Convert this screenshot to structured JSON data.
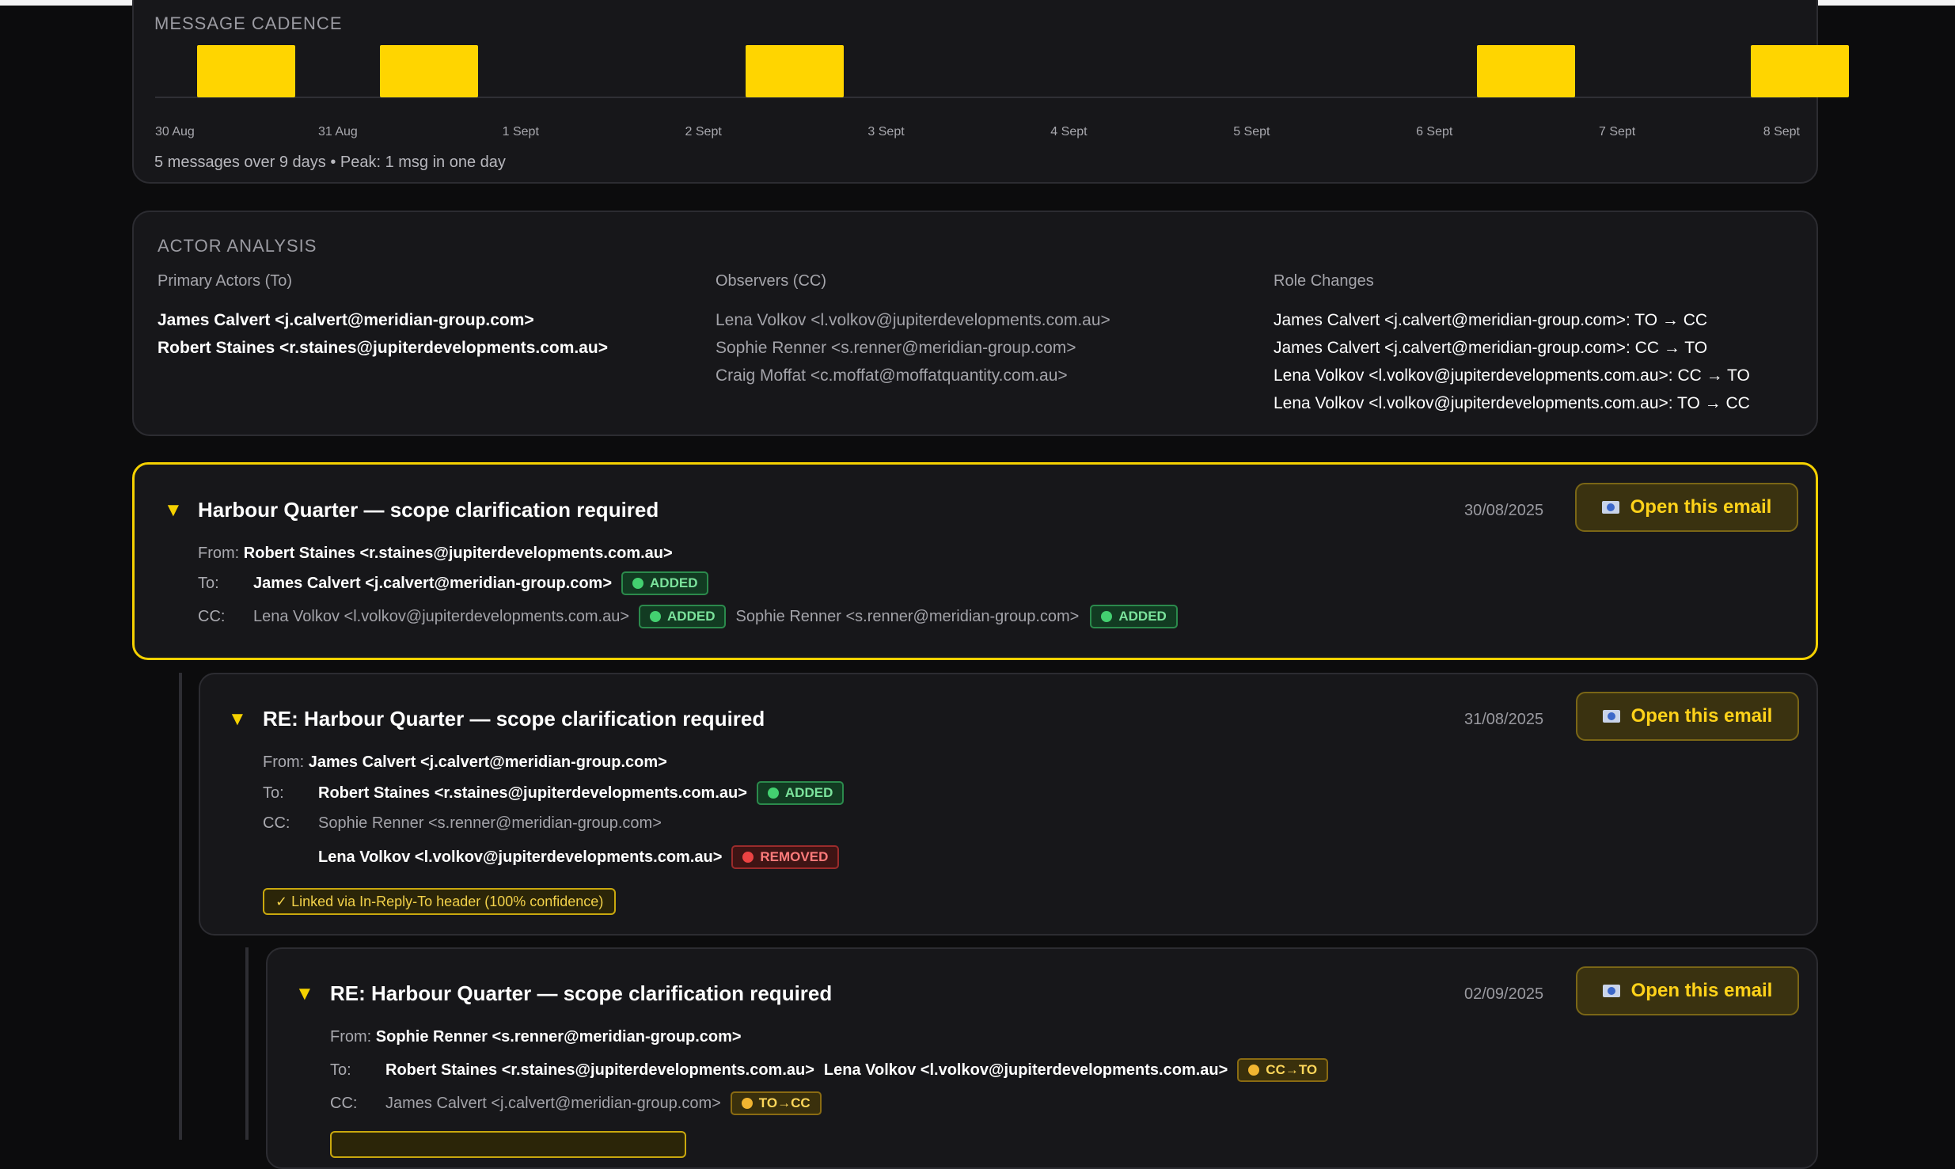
{
  "cadence": {
    "title": "MESSAGE CADENCE",
    "ticks": [
      "30 Aug",
      "31 Aug",
      "1 Sept",
      "2 Sept",
      "3 Sept",
      "4 Sept",
      "5 Sept",
      "6 Sept",
      "7 Sept",
      "8 Sept"
    ],
    "counts": [
      1,
      1,
      0,
      1,
      0,
      0,
      0,
      1,
      0,
      1
    ],
    "bar_color": "#ffd500",
    "summary": "5 messages over 9 days • Peak: 1 msg in one day"
  },
  "actor_analysis": {
    "title": "ACTOR ANALYSIS",
    "primary": {
      "heading": "Primary Actors (To)",
      "items": [
        "James Calvert <j.calvert@meridian-group.com>",
        "Robert Staines <r.staines@jupiterdevelopments.com.au>"
      ]
    },
    "observers": {
      "heading": "Observers (CC)",
      "items": [
        "Lena Volkov <l.volkov@jupiterdevelopments.com.au>",
        "Sophie Renner <s.renner@meridian-group.com>",
        "Craig Moffat <c.moffat@moffatquantity.com.au>"
      ]
    },
    "role_changes": {
      "heading": "Role Changes",
      "items": [
        "James Calvert <j.calvert@meridian-group.com>: TO → CC",
        "James Calvert <j.calvert@meridian-group.com>: CC → TO",
        "Lena Volkov <l.volkov@jupiterdevelopments.com.au>: CC → TO",
        "Lena Volkov <l.volkov@jupiterdevelopments.com.au>: TO → CC"
      ]
    }
  },
  "common": {
    "open_label": "Open this email",
    "from_label": "From:",
    "to_label": "To:",
    "cc_label": "CC:",
    "caret": "▼",
    "accent": "#f5d100"
  },
  "emails": [
    {
      "subject": "Harbour Quarter — scope clarification required",
      "date": "30/08/2025",
      "from": "Robert Staines <r.staines@jupiterdevelopments.com.au>",
      "to": [
        {
          "name": "James Calvert <j.calvert@meridian-group.com>",
          "badge": "ADDED"
        }
      ],
      "cc": [
        {
          "name": "Lena Volkov <l.volkov@jupiterdevelopments.com.au>",
          "badge": "ADDED"
        },
        {
          "name": "Sophie Renner <s.renner@meridian-group.com>",
          "badge": "ADDED"
        }
      ]
    },
    {
      "subject": "RE: Harbour Quarter — scope clarification required",
      "date": "31/08/2025",
      "from": "James Calvert <j.calvert@meridian-group.com>",
      "to": [
        {
          "name": "Robert Staines <r.staines@jupiterdevelopments.com.au>",
          "badge": "ADDED"
        }
      ],
      "cc": [
        {
          "name": "Sophie Renner <s.renner@meridian-group.com>",
          "badge": ""
        },
        {
          "name": "Lena Volkov <l.volkov@jupiterdevelopments.com.au>",
          "badge": "REMOVED"
        }
      ],
      "link_note": "✓ Linked via In-Reply-To header (100% confidence)"
    },
    {
      "subject": "RE: Harbour Quarter — scope clarification required",
      "date": "02/09/2025",
      "from": "Sophie Renner <s.renner@meridian-group.com>",
      "to": [
        {
          "name": "Robert Staines <r.staines@jupiterdevelopments.com.au>",
          "badge": ""
        },
        {
          "name": "Lena Volkov <l.volkov@jupiterdevelopments.com.au>",
          "badge": "CC→TO"
        }
      ],
      "cc": [
        {
          "name": "James Calvert <j.calvert@meridian-group.com>",
          "badge": "TO→CC"
        }
      ]
    }
  ]
}
